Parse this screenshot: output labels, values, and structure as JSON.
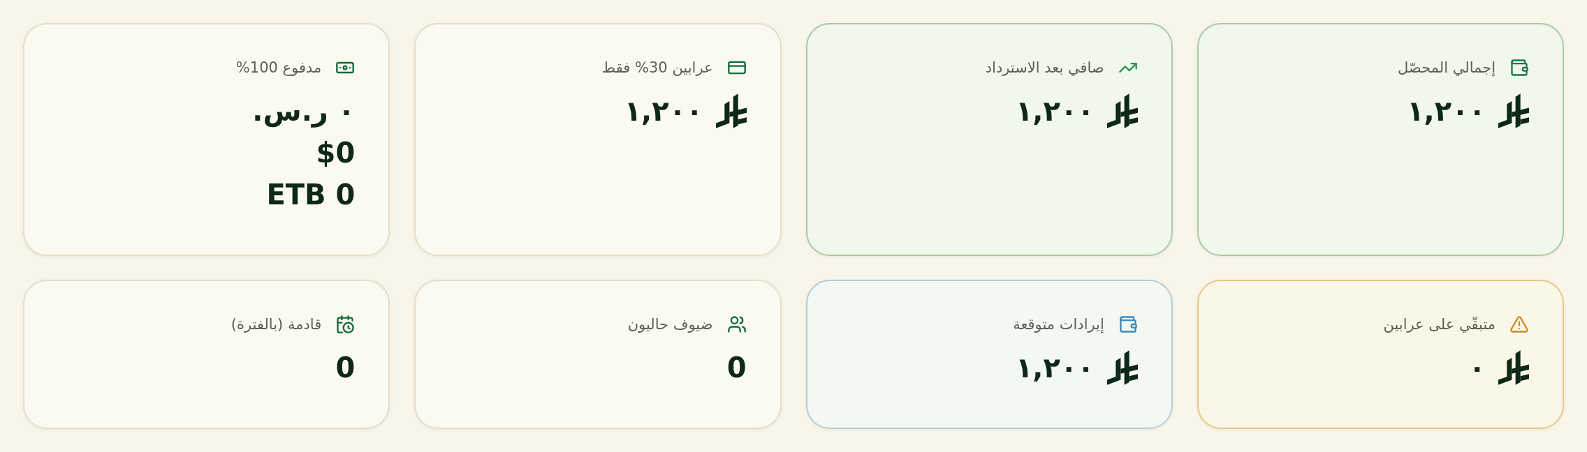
{
  "stats": [
    {
      "label": "إجمالي المحصّل",
      "color": "#a6cbaa",
      "icon": {
        "color": "#157a45"
      },
      "currency_symbol": true,
      "values": [
        "١,٢٠٠"
      ]
    },
    {
      "label": "صافي بعد الاسترداد",
      "color": "#a6cbaa",
      "icon": {
        "color": "#22924f"
      },
      "currency_symbol": true,
      "values": [
        "١,٢٠٠"
      ]
    },
    {
      "label": "عرابين 30% فقط",
      "color": "#e4decd",
      "icon": {
        "color": "#0f6a3c"
      },
      "currency_symbol": true,
      "values": [
        "١,٢٠٠"
      ]
    },
    {
      "label": "مدفوع 100%",
      "color": "#e4decd",
      "icon": {
        "color": "#0f6a3c"
      },
      "currency_symbol": false,
      "values": [
        "٠ ر.س.",
        "$0",
        "ETB 0"
      ]
    },
    {
      "label": "متبقّي على عرابين",
      "color": "#e7c78d",
      "icon": {
        "color": "#c98a2a"
      },
      "currency_symbol": true,
      "values": [
        "٠"
      ]
    },
    {
      "label": "إيرادات متوقعة",
      "color": "#b4ced9",
      "icon": {
        "color": "#3a88bd"
      },
      "currency_symbol": true,
      "values": [
        "١,٢٠٠"
      ]
    },
    {
      "label": "ضيوف حاليون",
      "color": "#e4decd",
      "icon": {
        "color": "#0f6a3c"
      },
      "currency_symbol": false,
      "values": [
        "0"
      ]
    },
    {
      "label": "قادمة (بالفترة)",
      "color": "#e4decd",
      "icon": {
        "color": "#0f6a3c"
      },
      "currency_symbol": false,
      "values": [
        "0"
      ]
    }
  ]
}
